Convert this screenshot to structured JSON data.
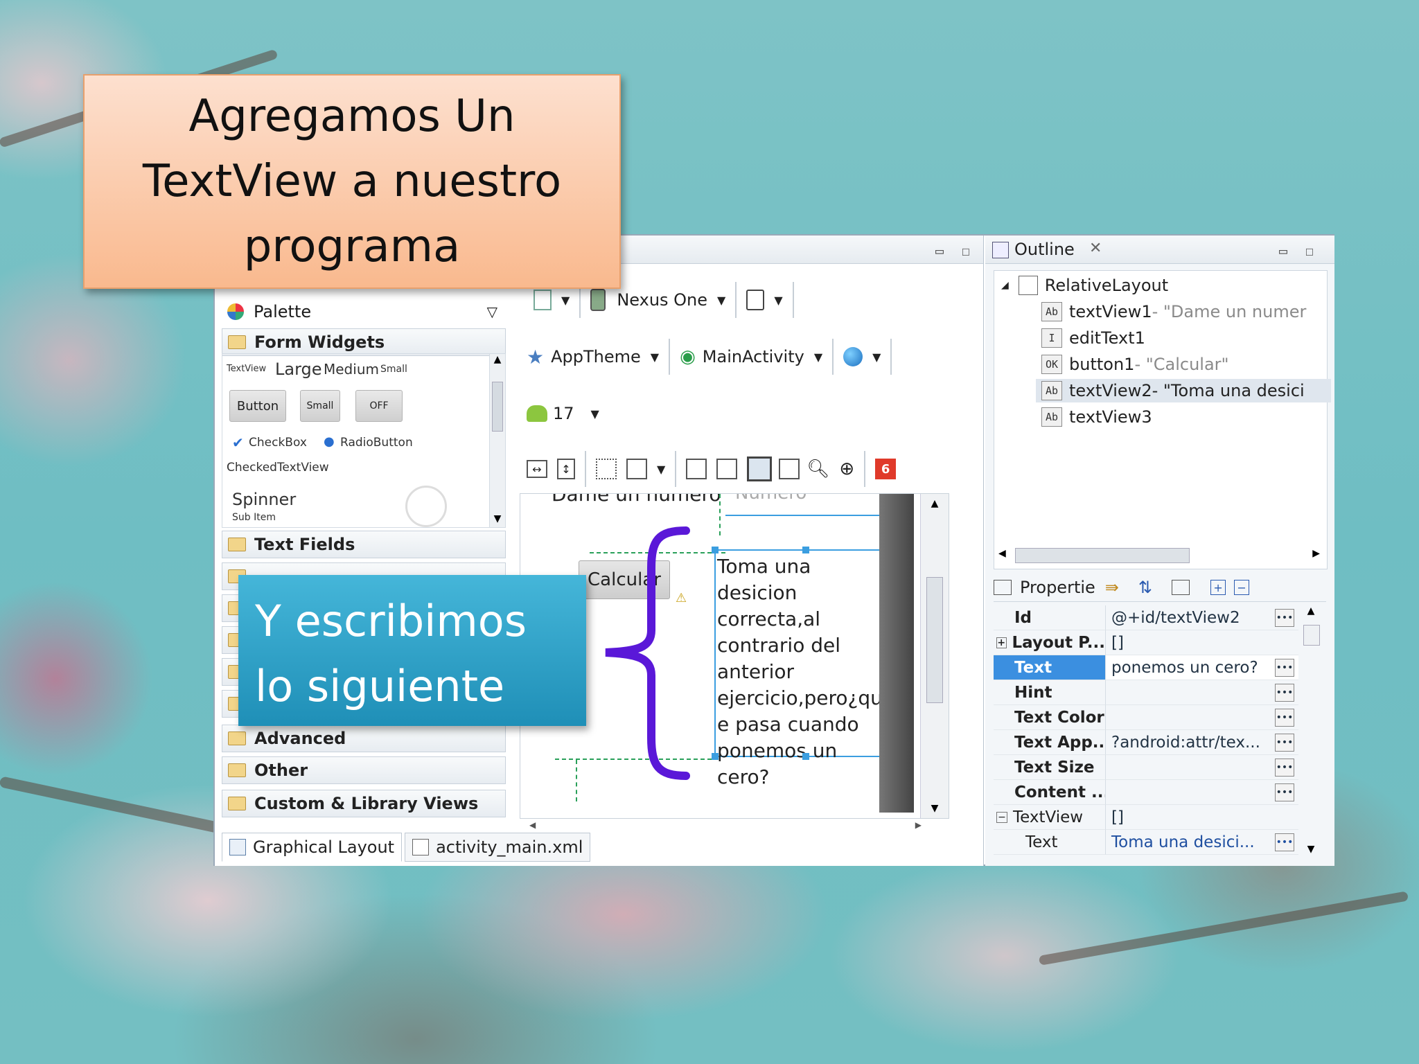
{
  "callouts": {
    "title_line1": "Agregamos Un",
    "title_line2": "TextView a nuestro",
    "title_line3": "programa",
    "note_line1": "Y escribimos",
    "note_line2": "lo siguiente"
  },
  "palette": {
    "title": "Palette",
    "folders": {
      "form_widgets": "Form Widgets",
      "text_fields": "Text Fields",
      "advanced": "Advanced",
      "other": "Other",
      "custom": "Custom & Library Views"
    },
    "widgets": {
      "textview": "TextView",
      "large": "Large",
      "medium": "Medium",
      "small": "Small",
      "button": "Button",
      "small_button": "Small",
      "off": "OFF",
      "checkbox": "CheckBox",
      "radio": "RadioButton",
      "checked_textview": "CheckedTextView",
      "spinner": "Spinner",
      "sub_item": "Sub Item"
    }
  },
  "toolbar": {
    "device": "Nexus One",
    "theme": "AppTheme",
    "activity": "MainActivity",
    "api": "17",
    "error_count": "6"
  },
  "canvas": {
    "label_text": "Dame un numero",
    "edit_hint": "Numero",
    "button_label": "Calcular",
    "textview2_text": "Toma una desicion correcta,al contrario del anterior ejercicio,pero¿que pasa cuando ponemos un cero?"
  },
  "bottom_tabs": {
    "graphical": "Graphical Layout",
    "xml": "activity_main.xml"
  },
  "outline": {
    "title": "Outline",
    "root": "RelativeLayout",
    "items": [
      {
        "id": "textView1",
        "value": " - \"Dame un numer"
      },
      {
        "id": "editText1",
        "value": ""
      },
      {
        "id": "button1",
        "value": " - \"Calcular\""
      },
      {
        "id": "textView2",
        "value": " - \"Toma una desici"
      },
      {
        "id": "textView3",
        "value": ""
      }
    ]
  },
  "properties": {
    "title": "Propertie",
    "rows": [
      {
        "key": "Id",
        "value": "@+id/textView2"
      },
      {
        "key": "Layout P...",
        "value": "[]"
      },
      {
        "key": "Text",
        "value": "ponemos un cero?"
      },
      {
        "key": "Hint",
        "value": ""
      },
      {
        "key": "Text Color",
        "value": ""
      },
      {
        "key": "Text App...",
        "value": "?android:attr/tex..."
      },
      {
        "key": "Text Size",
        "value": ""
      },
      {
        "key": "Content ...",
        "value": ""
      },
      {
        "key": "TextView",
        "value": "[]"
      },
      {
        "key": "Text",
        "value": "Toma una desici..."
      }
    ]
  },
  "colors": {
    "accent_selected": "#3b8fe0",
    "brace": "#5a18d8",
    "error_badge": "#e03a2a"
  }
}
